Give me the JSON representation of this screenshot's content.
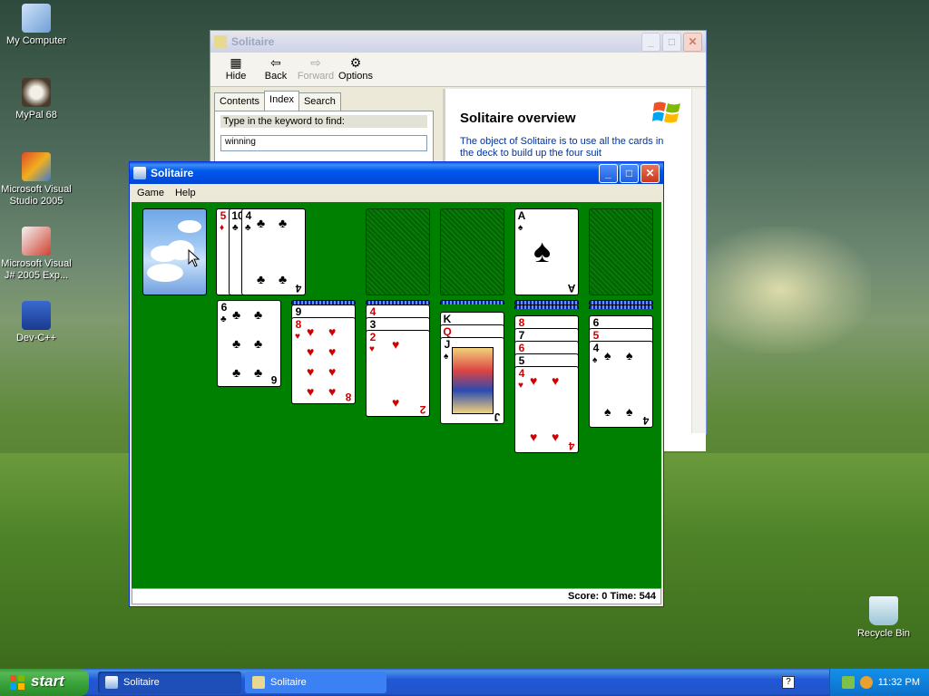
{
  "desktop": {
    "icons": [
      {
        "label": "My Computer"
      },
      {
        "label": "MyPal 68"
      },
      {
        "label": "Microsoft Visual Studio 2005"
      },
      {
        "label": "Microsoft Visual J# 2005 Exp..."
      },
      {
        "label": "Dev-C++"
      },
      {
        "label": "Recycle Bin"
      }
    ]
  },
  "help_window": {
    "title": "Solitaire",
    "toolbar": {
      "hide": "Hide",
      "back": "Back",
      "forward": "Forward",
      "options": "Options"
    },
    "tabs": [
      {
        "label": "Contents"
      },
      {
        "label": "Index"
      },
      {
        "label": "Search"
      }
    ],
    "keyword_label": "Type in the keyword to find:",
    "keyword_value": "winning",
    "heading": "Solitaire overview",
    "body_text": "The object of Solitaire is to use all the cards in the deck to build up the four suit"
  },
  "solitaire_window": {
    "title": "Solitaire",
    "menu": [
      {
        "label": "Game"
      },
      {
        "label": "Help"
      }
    ],
    "status": "Score: 0 Time: 544",
    "waste": [
      {
        "rank": "5",
        "suit": "♦",
        "color": "red"
      },
      {
        "rank": "10",
        "suit": "♣",
        "color": "black"
      },
      {
        "rank": "4",
        "suit": "♣",
        "color": "black"
      }
    ],
    "foundations": [
      {
        "rank": "",
        "suit": ""
      },
      {
        "rank": "",
        "suit": ""
      },
      {
        "rank": "A",
        "suit": "♠",
        "color": "black"
      },
      {
        "rank": "",
        "suit": ""
      }
    ],
    "tableau": [
      {
        "cards": [
          {
            "rank": "6",
            "suit": "♣",
            "color": "black"
          }
        ]
      },
      {
        "cards": [
          {
            "rank": "9",
            "suit": "♠",
            "color": "black"
          },
          {
            "rank": "8",
            "suit": "♥",
            "color": "red"
          }
        ]
      },
      {
        "cards": [
          {
            "rank": "4",
            "suit": "♥",
            "color": "red"
          },
          {
            "rank": "3",
            "suit": "♠",
            "color": "black"
          },
          {
            "rank": "2",
            "suit": "♥",
            "color": "red"
          }
        ]
      },
      {
        "cards": [
          {
            "rank": "K",
            "suit": "♣",
            "color": "black"
          },
          {
            "rank": "Q",
            "suit": "♥",
            "color": "red"
          },
          {
            "rank": "J",
            "suit": "♠",
            "color": "black"
          }
        ]
      },
      {
        "cards": [
          {
            "rank": "8",
            "suit": "♥",
            "color": "red"
          },
          {
            "rank": "7",
            "suit": "♠",
            "color": "black"
          },
          {
            "rank": "6",
            "suit": "♥",
            "color": "red"
          },
          {
            "rank": "5",
            "suit": "♠",
            "color": "black"
          },
          {
            "rank": "4",
            "suit": "♥",
            "color": "red"
          }
        ]
      },
      {
        "cards": [
          {
            "rank": "6",
            "suit": "♠",
            "color": "black"
          },
          {
            "rank": "5",
            "suit": "♥",
            "color": "red"
          },
          {
            "rank": "4",
            "suit": "♠",
            "color": "black"
          }
        ]
      }
    ]
  },
  "taskbar": {
    "start": "start",
    "buttons": [
      {
        "label": "Solitaire"
      },
      {
        "label": "Solitaire"
      }
    ],
    "clock": "11:32 PM"
  }
}
